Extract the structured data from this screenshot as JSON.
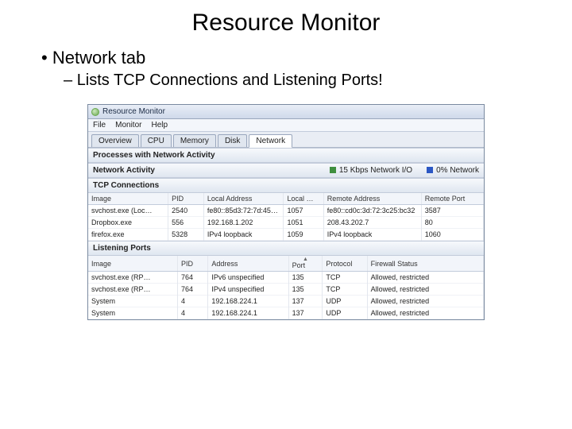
{
  "slide": {
    "title": "Resource Monitor",
    "bullet1": "Network tab",
    "bullet2": "Lists TCP Connections and Listening Ports!"
  },
  "window": {
    "title": "Resource Monitor",
    "menu": {
      "file": "File",
      "monitor": "Monitor",
      "help": "Help"
    },
    "tabs": {
      "overview": "Overview",
      "cpu": "CPU",
      "memory": "Memory",
      "disk": "Disk",
      "network": "Network"
    },
    "sections": {
      "processes": "Processes with Network Activity",
      "activity": "Network Activity",
      "tcp": "TCP Connections",
      "listening": "Listening Ports"
    },
    "activity": {
      "io_label": "15 Kbps Network I/O",
      "util_label": "0% Network"
    },
    "tcp_headers": {
      "image": "Image",
      "pid": "PID",
      "local_addr": "Local Address",
      "local_port": "Local …",
      "remote_addr": "Remote Address",
      "remote_port": "Remote Port"
    },
    "tcp_rows": [
      {
        "image": "svchost.exe (Loc…",
        "pid": "2540",
        "la": "fe80::85d3:72:7d:45…",
        "lp": "1057",
        "ra": "fe80::cd0c:3d:72:3c25:bc32",
        "rp": "3587"
      },
      {
        "image": "Dropbox.exe",
        "pid": "556",
        "la": "192.168.1.202",
        "lp": "1051",
        "ra": "208.43.202.7",
        "rp": "80"
      },
      {
        "image": "firefox.exe",
        "pid": "5328",
        "la": "IPv4 loopback",
        "lp": "1059",
        "ra": "IPv4 loopback",
        "rp": "1060"
      }
    ],
    "lp_headers": {
      "image": "Image",
      "pid": "PID",
      "addr": "Address",
      "port": "Port",
      "proto": "Protocol",
      "fw": "Firewall Status"
    },
    "lp_rows": [
      {
        "image": "svchost.exe (RP…",
        "pid": "764",
        "addr": "IPv6 unspecified",
        "port": "135",
        "proto": "TCP",
        "fw": "Allowed, restricted"
      },
      {
        "image": "svchost.exe (RP…",
        "pid": "764",
        "addr": "IPv4 unspecified",
        "port": "135",
        "proto": "TCP",
        "fw": "Allowed, restricted"
      },
      {
        "image": "System",
        "pid": "4",
        "addr": "192.168.224.1",
        "port": "137",
        "proto": "UDP",
        "fw": "Allowed, restricted"
      },
      {
        "image": "System",
        "pid": "4",
        "addr": "192.168.224.1",
        "port": "137",
        "proto": "UDP",
        "fw": "Allowed, restricted"
      }
    ]
  }
}
